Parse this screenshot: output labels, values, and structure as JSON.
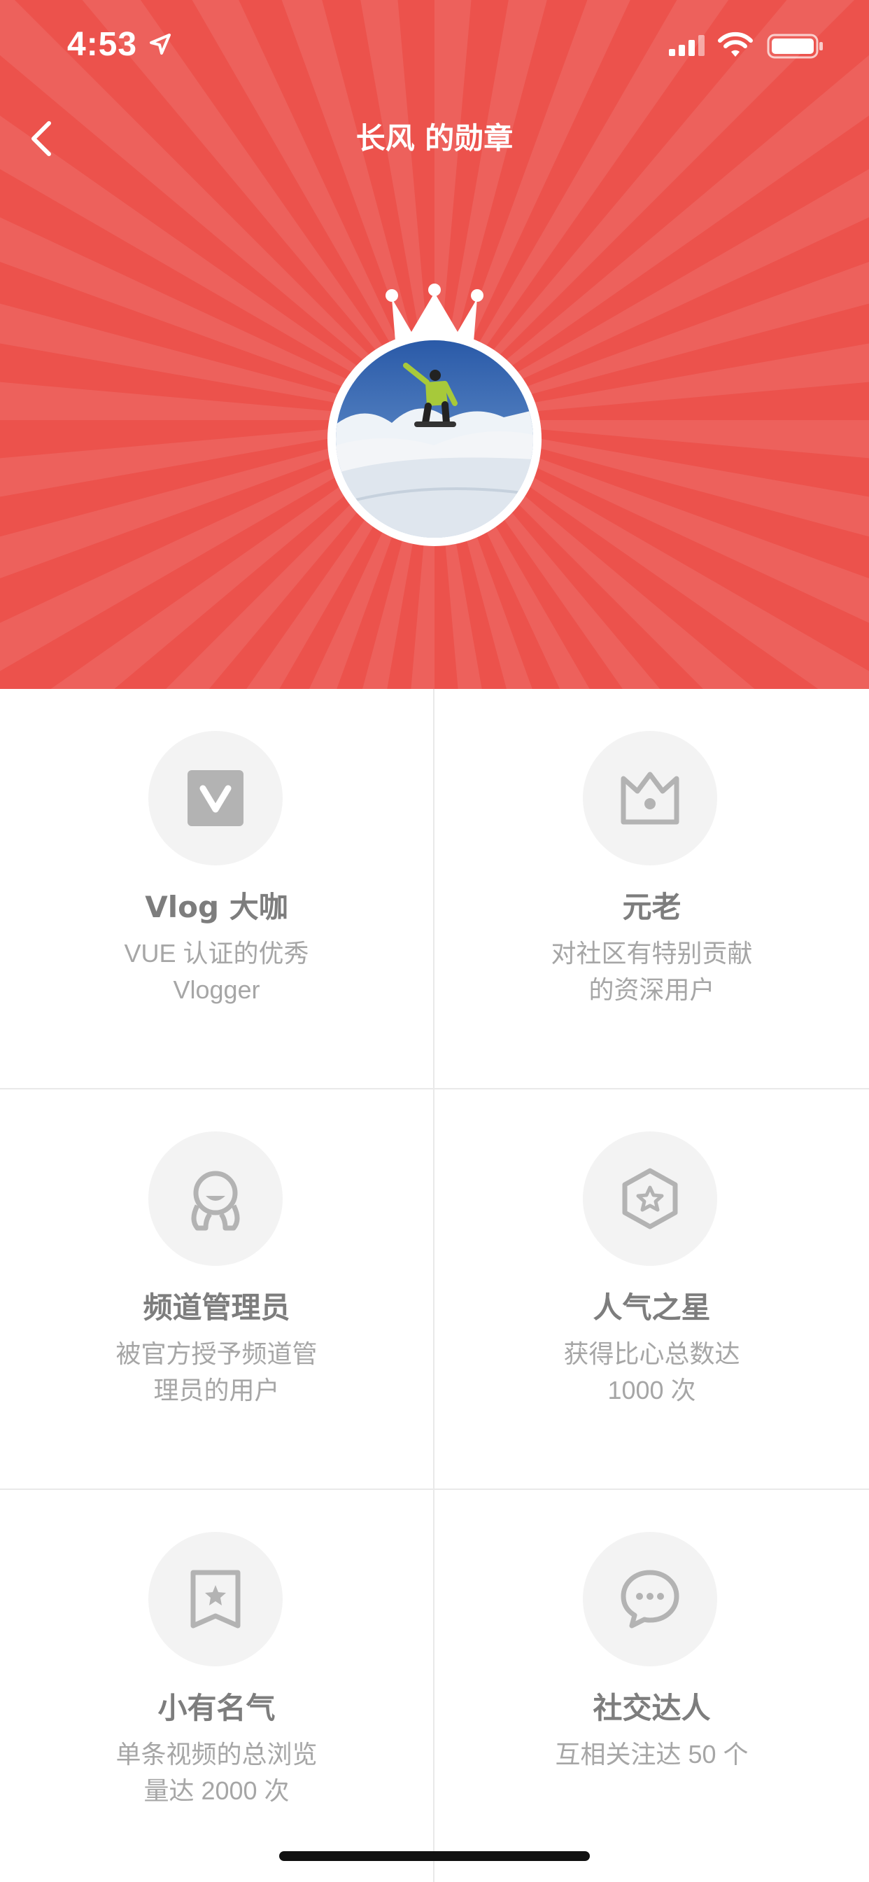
{
  "status_bar": {
    "time": "4:53"
  },
  "nav": {
    "title": "长风 的勋章"
  },
  "badges": [
    {
      "icon": "v-icon",
      "title": "Vlog 大咖",
      "desc": "VUE 认证的优秀 Vlogger"
    },
    {
      "icon": "crown-outline-icon",
      "title": "元老",
      "desc": "对社区有特别贡献的资深用户"
    },
    {
      "icon": "manager-icon",
      "title": "频道管理员",
      "desc": "被官方授予频道管理员的用户"
    },
    {
      "icon": "hexagon-star-icon",
      "title": "人气之星",
      "desc": "获得比心总数达 1000 次"
    },
    {
      "icon": "bookmark-star-icon",
      "title": "小有名气",
      "desc": "单条视频的总浏览量达 2000 次"
    },
    {
      "icon": "chat-bubble-icon",
      "title": "社交达人",
      "desc": "互相关注达 50 个"
    }
  ],
  "colors": {
    "header": "#ec524c",
    "icon_gray": "#b3b3b3",
    "title_gray": "#7d7d7d",
    "desc_gray": "#a6a6a6"
  }
}
